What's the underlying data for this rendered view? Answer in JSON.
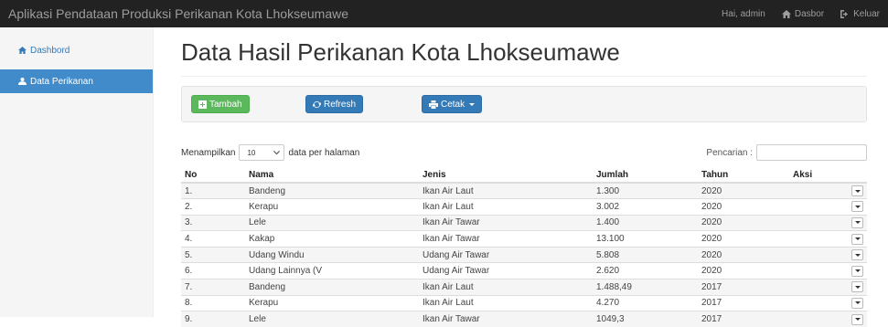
{
  "navbar": {
    "brand": "Aplikasi Pendataan Produksi Perikanan Kota Lhokseumawe",
    "greeting": "Hai, admin",
    "dashboard_link": "Dasbor",
    "logout_link": "Keluar"
  },
  "sidebar": {
    "items": [
      {
        "label": "Dashbord",
        "icon": "home-icon"
      },
      {
        "label": "Data Perikanan",
        "icon": "user-icon"
      }
    ],
    "accent": "#428bca"
  },
  "main": {
    "title": "Data Hasil Perikanan Kota Lhokseumawe",
    "toolbar": {
      "add_label": "Tambah",
      "refresh_label": "Refresh",
      "print_label": "Cetak"
    },
    "length": {
      "prefix": "Menampilkan",
      "value": "10",
      "suffix": "data per halaman"
    },
    "search": {
      "label": "Pencarian :",
      "value": ""
    },
    "table": {
      "columns": [
        "No",
        "Nama",
        "Jenis",
        "Jumlah",
        "Tahun",
        "Aksi"
      ],
      "rows": [
        {
          "no": "1.",
          "nama": "Bandeng",
          "jenis": "Ikan Air Laut",
          "jumlah": "1.300",
          "tahun": "2020"
        },
        {
          "no": "2.",
          "nama": "Kerapu",
          "jenis": "Ikan Air Laut",
          "jumlah": "3.002",
          "tahun": "2020"
        },
        {
          "no": "3.",
          "nama": "Lele",
          "jenis": "Ikan Air Tawar",
          "jumlah": "1.400",
          "tahun": "2020"
        },
        {
          "no": "4.",
          "nama": "Kakap",
          "jenis": "Ikan Air Tawar",
          "jumlah": "13.100",
          "tahun": "2020"
        },
        {
          "no": "5.",
          "nama": "Udang Windu",
          "jenis": "Udang Air Tawar",
          "jumlah": "5.808",
          "tahun": "2020"
        },
        {
          "no": "6.",
          "nama": "Udang Lainnya (V",
          "jenis": "Udang Air Tawar",
          "jumlah": "2.620",
          "tahun": "2020"
        },
        {
          "no": "7.",
          "nama": "Bandeng",
          "jenis": "Ikan Air Laut",
          "jumlah": "1.488,49",
          "tahun": "2017"
        },
        {
          "no": "8.",
          "nama": "Kerapu",
          "jenis": "Ikan Air Laut",
          "jumlah": "4.270",
          "tahun": "2017"
        },
        {
          "no": "9.",
          "nama": "Lele",
          "jenis": "Ikan Air Tawar",
          "jumlah": "1049,3",
          "tahun": "2017"
        }
      ]
    }
  },
  "colors": {
    "navbar_bg": "#222222",
    "success": "#5cb85c",
    "primary": "#337ab7"
  }
}
